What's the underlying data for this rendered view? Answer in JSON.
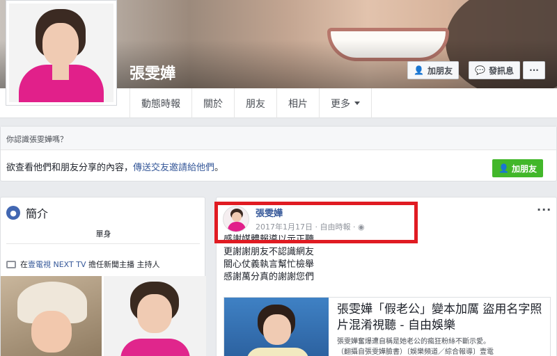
{
  "profile": {
    "name": "張雯嬅"
  },
  "header_buttons": {
    "add_friend": "加朋友",
    "message": "發訊息",
    "more": "···"
  },
  "tabs": [
    "動態時報",
    "關於",
    "朋友",
    "相片",
    "更多"
  ],
  "know_card": {
    "question": "你認識張雯嬅嗎？",
    "body_prefix": "欲查看他們和朋友分享的內容，",
    "body_link": "傳送交友邀請給他們",
    "body_suffix": "。",
    "add_friend": "加朋友"
  },
  "intro": {
    "title": "簡介",
    "status": "單身",
    "job_prefix": "在",
    "job_link": "壹電視 NEXT TV",
    "job_suffix": " 擔任新聞主播 主持人"
  },
  "post": {
    "author": "張雯嬅",
    "date": "2017年1月17日",
    "source": "自由時報",
    "more": "···",
    "lines": [
      "感謝媒體報導以示正聽",
      "更謝謝朋友不認識網友",
      "關心仗義執言幫忙檢舉",
      "感謝萬分真的謝謝您們"
    ],
    "link_title": "張雯嬅「假老公」變本加厲 盜用名字照片混淆視聽 - 自由娛樂",
    "link_desc_1": "張雯嬅奮爆遭自稱是她老公的瘋狂粉絲不斷示愛。",
    "link_desc_2": "（翻攝自張雯嬅臉書）〔娛樂頻道／綜合報導〕壹電"
  }
}
